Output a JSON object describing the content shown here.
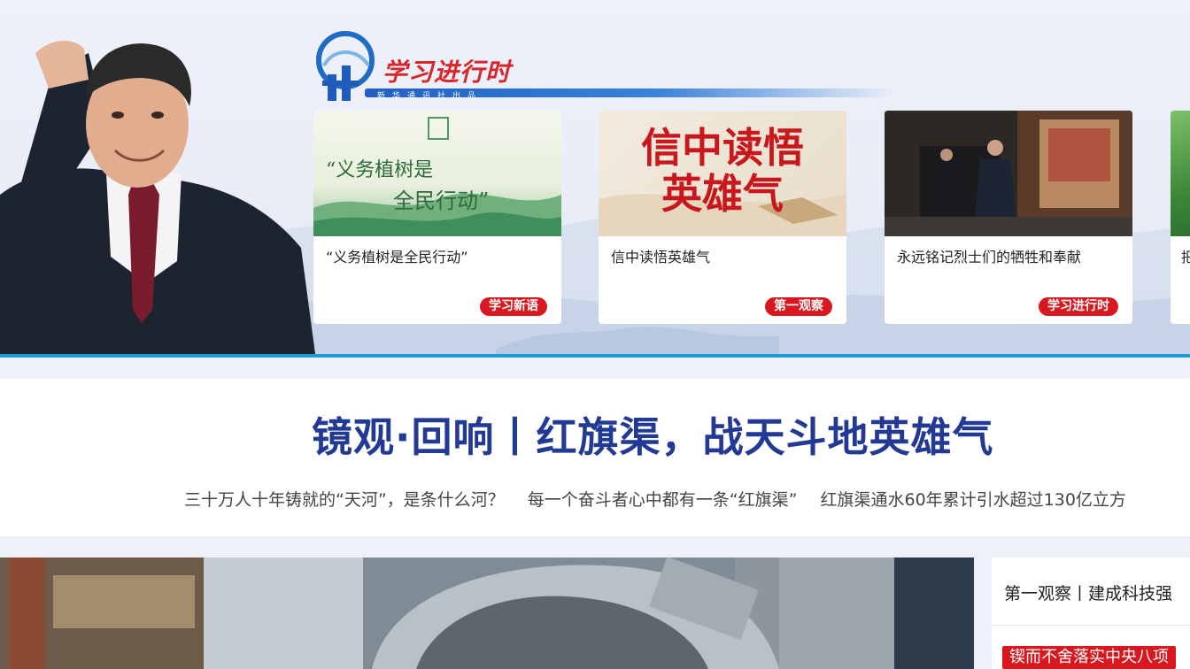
{
  "banner": {
    "brand_title": "学习进行时",
    "brand_subtitle": "新华通讯社出品",
    "cards": [
      {
        "title": "“义务植树是全民行动”",
        "tag": "学习新语",
        "image_text": [
          "“义务植树是",
          "全民行动”"
        ]
      },
      {
        "title": "信中读悟英雄气",
        "tag": "第一观察",
        "image_text": [
          "信中读悟",
          "英雄气"
        ]
      },
      {
        "title": "永远铭记烈士们的牺牲和奉献",
        "tag": "学习进行时"
      }
    ],
    "peek_card_title": "把"
  },
  "headline": {
    "title": "镜观·回响丨红旗渠，战天斗地英雄气",
    "links": [
      "三十万人十年铸就的“天河”，是条什么河？",
      "每一个奋斗者心中都有一条“红旗渠”",
      "红旗渠通水60年累计引水超过130亿立方"
    ]
  },
  "side": {
    "title": "第一观察丨建成科技强",
    "tag": "锲而不舍落实中央八项"
  },
  "colors": {
    "accent_red": "#d9171f",
    "headline_blue": "#233a94",
    "rule_blue": "#1e9bd7"
  },
  "icons": [
    "xinhua-logo-icon"
  ]
}
